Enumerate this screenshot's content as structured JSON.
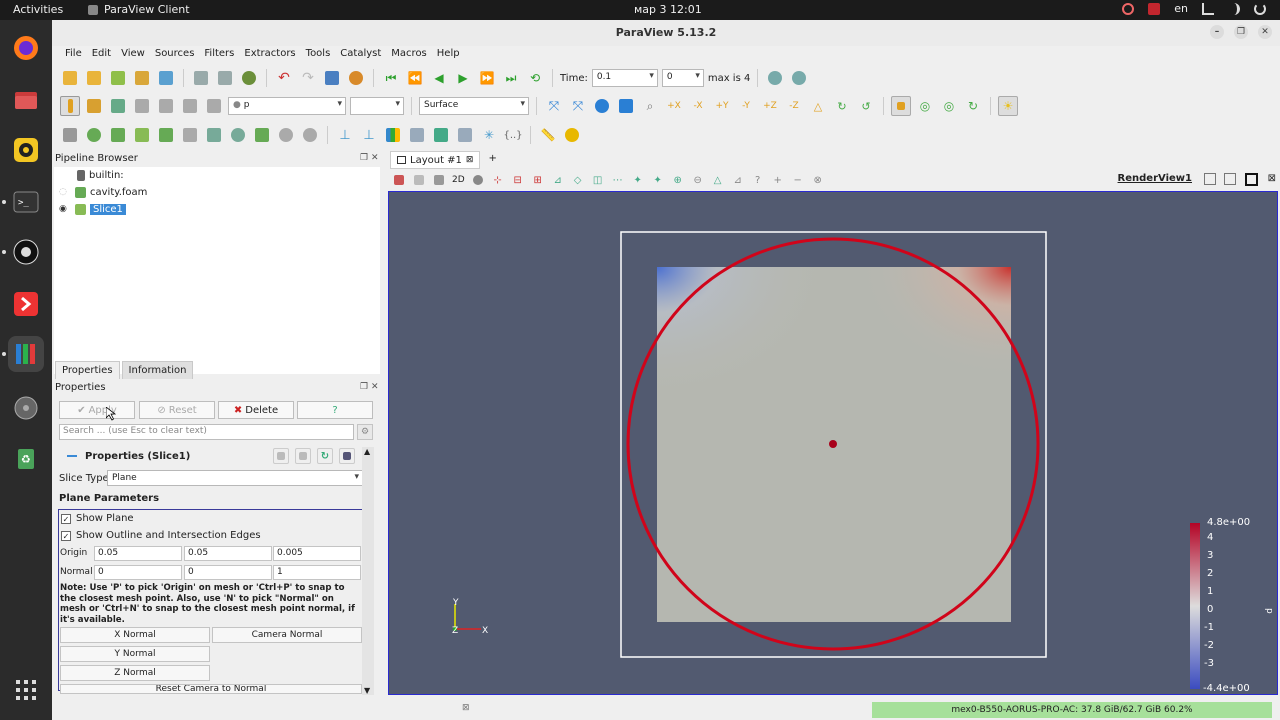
{
  "topbar": {
    "activities": "Activities",
    "app_name": "ParaView Client",
    "clock": "мар 3  12:01",
    "lang": "en"
  },
  "window": {
    "title": "ParaView 5.13.2"
  },
  "menu": [
    "File",
    "Edit",
    "View",
    "Sources",
    "Filters",
    "Extractors",
    "Tools",
    "Catalyst",
    "Macros",
    "Help"
  ],
  "time_toolbar": {
    "time_label": "Time:",
    "time_value": "0.1",
    "step_value": "0",
    "max_label": "max is 4"
  },
  "display_toolbar": {
    "color_by": "p",
    "representation": "Surface"
  },
  "pipeline": {
    "title": "Pipeline Browser",
    "items": [
      "builtin:",
      "cavity.foam",
      "Slice1"
    ]
  },
  "properties": {
    "tabs": [
      "Properties",
      "Information"
    ],
    "panel_title": "Properties",
    "apply": "Apply",
    "reset": "Reset",
    "delete": "Delete",
    "help": "?",
    "search_placeholder": "Search ... (use Esc to clear text)",
    "section_title": "Properties (Slice1)",
    "slice_type_label": "Slice Type",
    "slice_type_value": "Plane",
    "plane_params_label": "Plane Parameters",
    "show_plane": "Show Plane",
    "show_outline": "Show Outline and Intersection Edges",
    "origin_label": "Origin",
    "origin": [
      "0.05",
      "0.05",
      "0.005"
    ],
    "normal_label": "Normal",
    "normal": [
      "0",
      "0",
      "1"
    ],
    "note": "Note: Use 'P' to pick 'Origin' on mesh or 'Ctrl+P' to snap to the closest mesh point. Also, use 'N' to pick \"Normal\" on mesh or 'Ctrl+N' to snap to the closest mesh point normal, if it's available.",
    "x_normal": "X Normal",
    "camera_normal": "Camera Normal",
    "y_normal": "Y Normal",
    "z_normal": "Z Normal",
    "reset_camera_normal": "Reset Camera to Normal"
  },
  "layout": {
    "tab": "Layout #1",
    "add_tab": "+",
    "view_name": "RenderView1",
    "two_d": "2D"
  },
  "colorbar": {
    "max_label": "4.8e+00",
    "min_label": "-4.4e+00",
    "ticks": [
      "4",
      "3",
      "2",
      "1",
      "0",
      "-1",
      "-2",
      "-3"
    ],
    "title": "p"
  },
  "axes": {
    "x": "X",
    "y": "Y",
    "z": "Z"
  },
  "status": {
    "memory": "mex0-B550-AORUS-PRO-AC: 37.8 GiB/62.7 GiB 60.2%"
  },
  "colors": {
    "render_bg": "#525a70",
    "circle": "#d0041a",
    "selection": "#3a8ad6",
    "memory_bar": "#a6e09a"
  }
}
